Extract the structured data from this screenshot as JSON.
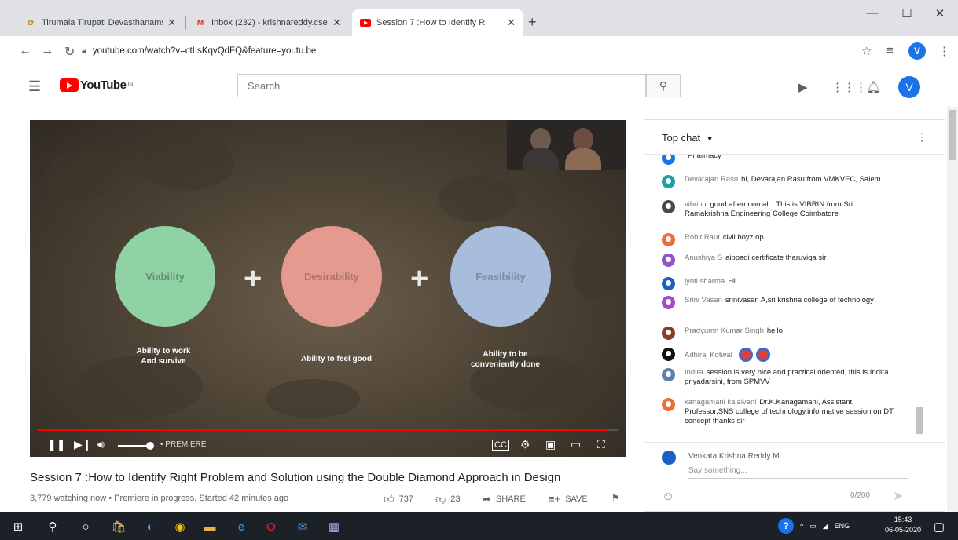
{
  "browser": {
    "tabs": [
      {
        "title": "Tirumala Tirupati Devasthanams",
        "active": false
      },
      {
        "title": "Inbox (232) - krishnareddy.cse@",
        "active": false
      },
      {
        "title": "Session 7 :How to Identify R",
        "active": true
      }
    ],
    "url": "youtube.com/watch?v=ctLsKqvQdFQ&feature=youtu.be",
    "profile_initial": "V"
  },
  "youtube": {
    "logo_text": "YouTube",
    "logo_region": "IN",
    "search_placeholder": "Search",
    "avatar_initial": "V"
  },
  "video": {
    "slide": {
      "circles": [
        {
          "label": "Viability",
          "caption": "Ability to work And survive",
          "color": "#8fd3a4"
        },
        {
          "label": "Desirability",
          "caption": "Ability to feel good",
          "color": "#e49a8e"
        },
        {
          "label": "Feasibility",
          "caption": "Ability to be conveniently done",
          "color": "#a8bcdc"
        }
      ]
    },
    "progress": 0.98,
    "premiere_label": "• PREMIERE",
    "title": "Session 7 :How to Identify Right Problem and Solution using the Double Diamond Approach in Design",
    "meta": "3,779 watching now • Premiere in progress. Started 42 minutes ago",
    "likes": "737",
    "dislikes": "23",
    "share_label": "SHARE",
    "save_label": "SAVE"
  },
  "chat": {
    "title": "Top chat",
    "messages": [
      {
        "author": "",
        "text": "Pharmacy",
        "avatar_color": "#1a73e8"
      },
      {
        "author": "Devarajan Rasu",
        "text": "hi, Devarajan Rasu from VMKVEC, Salem",
        "avatar_color": "#1e9ea8"
      },
      {
        "author": "vibrin r",
        "text": "good afternoon all , This is VIBRIN from Sri Ramakrishna Engineering College Coimbatore",
        "avatar_color": "#4a4a4a"
      },
      {
        "author": "Rohit Raut",
        "text": "civil boyz op",
        "avatar_color": "#ef6c37"
      },
      {
        "author": "Anushiya S",
        "text": "aippadi certificate tharuviga sir",
        "avatar_color": "#8e55c9"
      },
      {
        "author": "jyoti sharma",
        "text": "Hii",
        "avatar_color": "#1a5fc2"
      },
      {
        "author": "Srini Vasan",
        "text": "srinivasan A,sri krishna college of technology",
        "avatar_color": "#a64ac9"
      },
      {
        "author": "Pradyumn Kumar Singh",
        "text": "hello",
        "avatar_color": "#8a3b2a"
      },
      {
        "author": "Adhiraj Kotwal",
        "text": "",
        "avatar_color": "#111111"
      },
      {
        "author": "Indira",
        "text": "session is very nice and practical oriented, this is Indira priyadarsini, from SPMVV",
        "avatar_color": "#5b7fb3"
      },
      {
        "author": "kanagamani kalaivani",
        "text": "Dr.K.Kanagamani, Assistant Professor,SNS college of technology,informative session on DT concept thanks sir",
        "avatar_color": "#ef6c37"
      }
    ],
    "input_user": "Venkata Krishna Reddy M",
    "input_placeholder": "Say something...",
    "char_count": "0/200"
  },
  "taskbar": {
    "lang": "ENG",
    "time": "15:43",
    "date": "06-05-2020"
  }
}
